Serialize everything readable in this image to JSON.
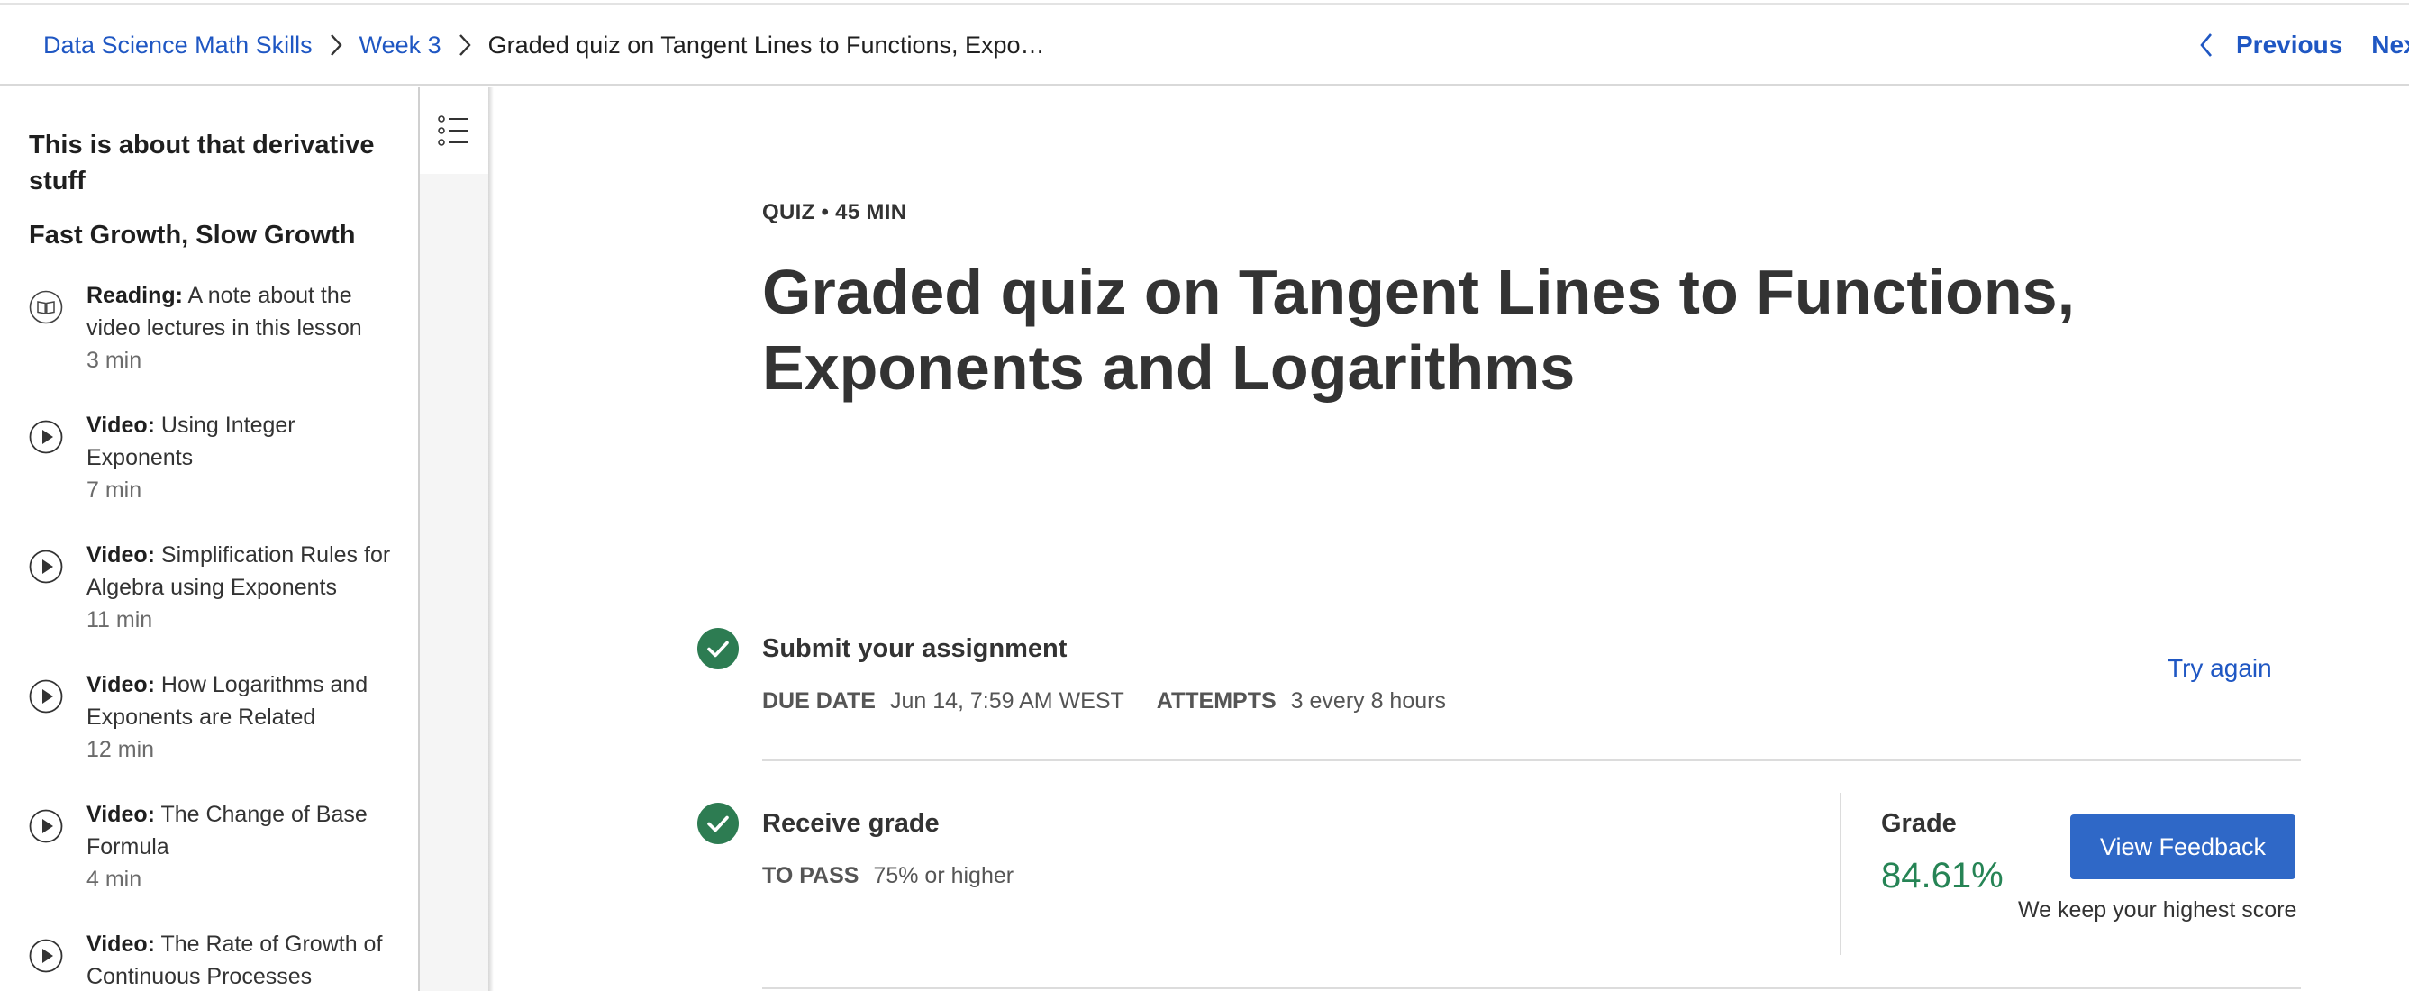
{
  "breadcrumb": {
    "items": [
      "Data Science Math Skills",
      "Week 3"
    ],
    "current": "Graded quiz on Tangent Lines to Functions, Expo…"
  },
  "nav": {
    "previous": "Previous",
    "next": "Next"
  },
  "sidebar": {
    "heading": "This is about that derivative stuff",
    "subheading": "Fast Growth, Slow Growth",
    "items": [
      {
        "type": "Reading:",
        "title": "A note about the video lectures in this lesson",
        "duration": "3 min",
        "icon": "book-icon"
      },
      {
        "type": "Video:",
        "title": "Using Integer Exponents",
        "duration": "7 min",
        "icon": "play-icon"
      },
      {
        "type": "Video:",
        "title": "Simplification Rules for Algebra using Exponents",
        "duration": "11 min",
        "icon": "play-icon"
      },
      {
        "type": "Video:",
        "title": "How Logarithms and Exponents are Related",
        "duration": "12 min",
        "icon": "play-icon"
      },
      {
        "type": "Video:",
        "title": "The Change of Base Formula",
        "duration": "4 min",
        "icon": "play-icon"
      },
      {
        "type": "Video:",
        "title": "The Rate of Growth of Continuous Processes",
        "duration": "",
        "icon": "play-icon"
      }
    ]
  },
  "quiz": {
    "kicker": "QUIZ • 45 MIN",
    "title": "Graded quiz on Tangent Lines to Functions, Exponents and Logarithms"
  },
  "submit": {
    "title": "Submit your assignment",
    "due_label": "DUE DATE",
    "due_value": "Jun 14, 7:59 AM WEST",
    "attempts_label": "ATTEMPTS",
    "attempts_value": "3 every 8 hours",
    "try_again": "Try again"
  },
  "grade": {
    "title": "Receive grade",
    "pass_label": "TO PASS",
    "pass_value": "75% or higher",
    "grade_label": "Grade",
    "grade_value": "84.61%",
    "feedback_button": "View Feedback",
    "note": "We keep your highest score"
  },
  "colors": {
    "link": "#1f57c3",
    "success": "#2d7c52",
    "grade": "#268455",
    "button": "#2f68c7"
  }
}
